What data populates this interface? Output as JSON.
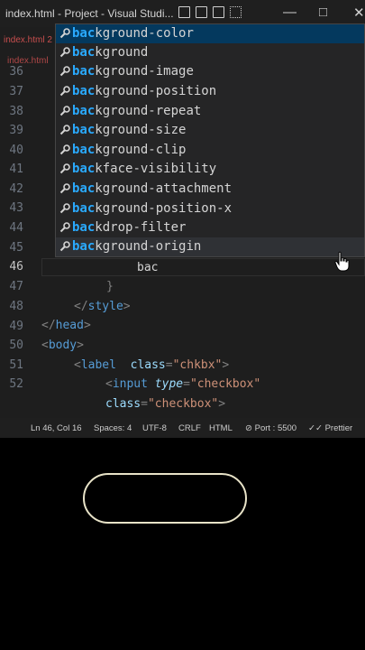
{
  "window": {
    "title": "index.html - Project - Visual Studi..."
  },
  "tabs": [
    {
      "label": "index.html 2"
    }
  ],
  "breadcrumb": {
    "label": "index.html"
  },
  "line_numbers": [
    "36",
    "37",
    "38",
    "39",
    "40",
    "41",
    "42",
    "43",
    "44",
    "45",
    "46",
    "47",
    "48",
    "49",
    "50",
    "51",
    "52"
  ],
  "code": {
    "typed": "bac",
    "brace_close": "}",
    "style_open": "</",
    "style_name": "style",
    "head_open": "</",
    "head_name": "head",
    "body_lt": "<",
    "body_name": "body",
    "label_lt": "<",
    "label_name": "label",
    "label_attr": "class",
    "label_eq": "=",
    "label_val": "\"chkbx\"",
    "input_lt": "<",
    "input_name": "input",
    "input_attr": "type",
    "input_eq": "=",
    "input_val": "\"checkbox\"",
    "class_attr": "class",
    "class_eq": "=",
    "class_val": "\"checkbox\"",
    "gt": ">"
  },
  "suggestions": [
    {
      "match": "bac",
      "rest": "kground-color",
      "icon": "wrench-icon"
    },
    {
      "match": "bac",
      "rest": "kground",
      "icon": "wrench-icon"
    },
    {
      "match": "bac",
      "rest": "kground-image",
      "icon": "wrench-icon"
    },
    {
      "match": "bac",
      "rest": "kground-position",
      "icon": "wrench-icon"
    },
    {
      "match": "bac",
      "rest": "kground-repeat",
      "icon": "wrench-icon"
    },
    {
      "match": "bac",
      "rest": "kground-size",
      "icon": "wrench-icon"
    },
    {
      "match": "bac",
      "rest": "kground-clip",
      "icon": "wrench-icon"
    },
    {
      "match": "bac",
      "rest": "kface-visibility",
      "icon": "wrench-icon"
    },
    {
      "match": "bac",
      "rest": "kground-attachment",
      "icon": "wrench-icon"
    },
    {
      "match": "bac",
      "rest": "kground-position-x",
      "icon": "wrench-icon"
    },
    {
      "match": "bac",
      "rest": "kdrop-filter",
      "icon": "wrench-icon"
    },
    {
      "match": "bac",
      "rest": "kground-origin",
      "icon": "wrench-icon"
    }
  ],
  "statusbar": {
    "position": "Ln 46, Col 16",
    "spaces": "Spaces: 4",
    "encoding": "UTF-8",
    "eol": "CRLF",
    "language": "HTML",
    "port": "Port : 5500",
    "formatter": "Prettier"
  },
  "colors": {
    "editor_bg": "#1e1e1e",
    "suggest_bg": "#252526",
    "selected_bg": "#04395e",
    "match_highlight": "#2aaaff",
    "pill_border": "#e8e3c8"
  }
}
